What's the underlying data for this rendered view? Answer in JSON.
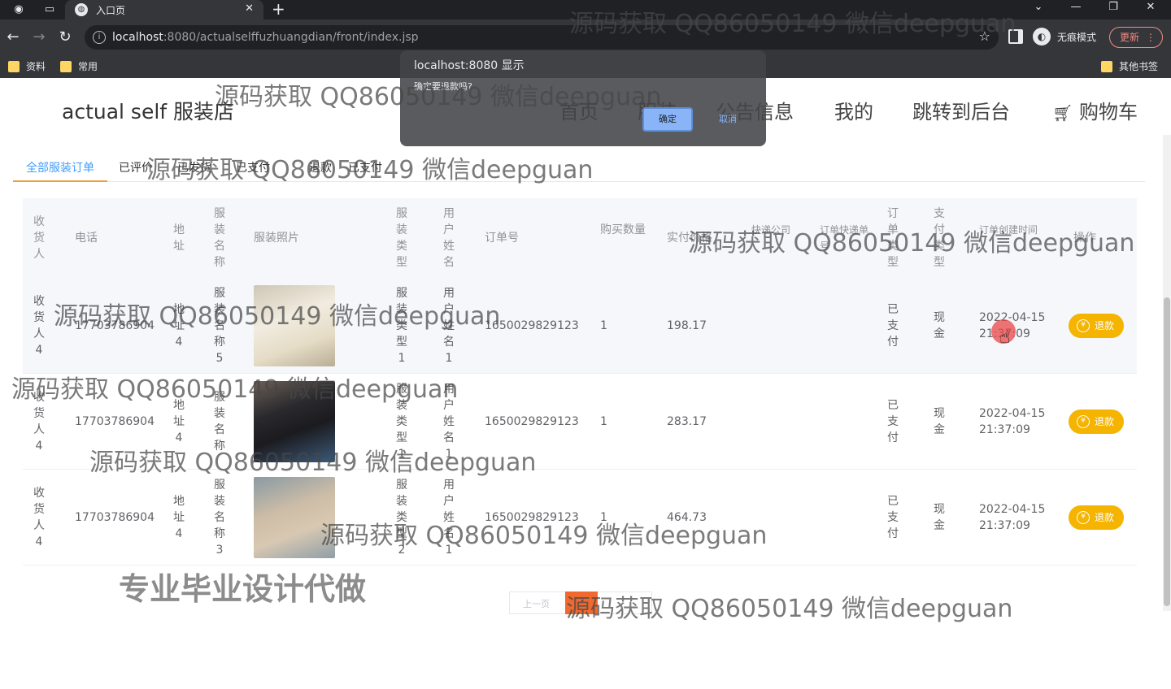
{
  "browser": {
    "tab_title": "入口页",
    "url_host": "localhost",
    "url_rest": ":8080/actualselffuzhuangdian/front/index.jsp",
    "incognito_label": "无痕模式",
    "update_label": "更新",
    "bookmarks": [
      "资料",
      "常用"
    ],
    "other_bookmarks": "其他书签"
  },
  "dialog": {
    "title": "localhost:8080 显示",
    "message": "确定要退款吗?",
    "ok": "确定",
    "cancel": "取消"
  },
  "site": {
    "brand": "actual self 服装店",
    "nav": [
      "首页",
      "服装",
      "公告信息",
      "我的",
      "跳转到后台",
      "购物车"
    ]
  },
  "order_tabs": [
    "全部服装订单",
    "已评价",
    "已发货",
    "已支付",
    "退款",
    "已支付"
  ],
  "table": {
    "headers": [
      "收货人",
      "电话",
      "地址",
      "服装名称",
      "服装照片",
      "服装类型",
      "用户姓名",
      "订单号",
      "购买数量",
      "实付价格",
      "快递公司",
      "订单快递单号",
      "订单类型",
      "支付类型",
      "订单创建时间",
      "操作"
    ],
    "rows": [
      {
        "receiver": "收货人4",
        "phone": "17703786904",
        "address": "地址4",
        "name": "服装名称5",
        "type": "服装类型1",
        "user": "用户姓名1",
        "order_no": "1650029829123",
        "qty": "1",
        "price": "198.17",
        "status": "已支付",
        "pay": "现金",
        "created": "2022-04-15 21:37:09",
        "action": "退款"
      },
      {
        "receiver": "收货人4",
        "phone": "17703786904",
        "address": "地址4",
        "name": "服装名称",
        "type": "服装类型1",
        "user": "用户姓名1",
        "order_no": "1650029829123",
        "qty": "1",
        "price": "283.17",
        "status": "已支付",
        "pay": "现金",
        "created": "2022-04-15 21:37:09",
        "action": "退款"
      },
      {
        "receiver": "收货人4",
        "phone": "17703786904",
        "address": "地址4",
        "name": "服装名称3",
        "type": "服装类型2",
        "user": "用户姓名1",
        "order_no": "1650029829123",
        "qty": "1",
        "price": "464.73",
        "status": "已支付",
        "pay": "现金",
        "created": "2022-04-15 21:37:09",
        "action": "退款"
      }
    ]
  },
  "pager": {
    "prev": "上一页"
  },
  "watermark": {
    "text": "源码获取 QQ86050149 微信deepguan",
    "banner": "专业毕业设计代做"
  },
  "colors": {
    "accent": "#409eff",
    "refund": "#f5b400",
    "tab_underline": "#e6a23c",
    "chrome": "#35363a"
  }
}
